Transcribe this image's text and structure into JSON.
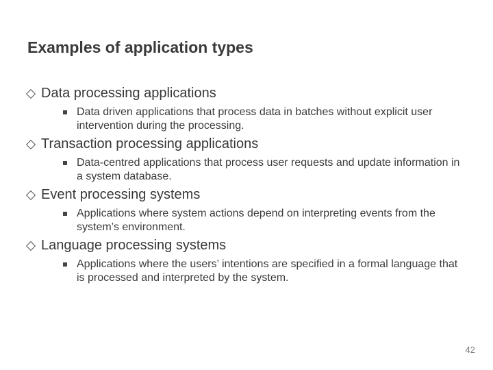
{
  "title": "Examples of application types",
  "sections": [
    {
      "heading": "Data processing applications",
      "sub": "Data driven applications that process data in batches without explicit user intervention during the processing."
    },
    {
      "heading": "Transaction processing applications",
      "sub": "Data-centred applications that process user requests and update information in a system database."
    },
    {
      "heading": "Event processing systems",
      "sub": "Applications where system actions depend on interpreting events from the system’s environment."
    },
    {
      "heading": "Language processing systems",
      "sub": "Applications where the users’ intentions are specified in a formal language that is processed and interpreted by the system."
    }
  ],
  "page_number": "42"
}
